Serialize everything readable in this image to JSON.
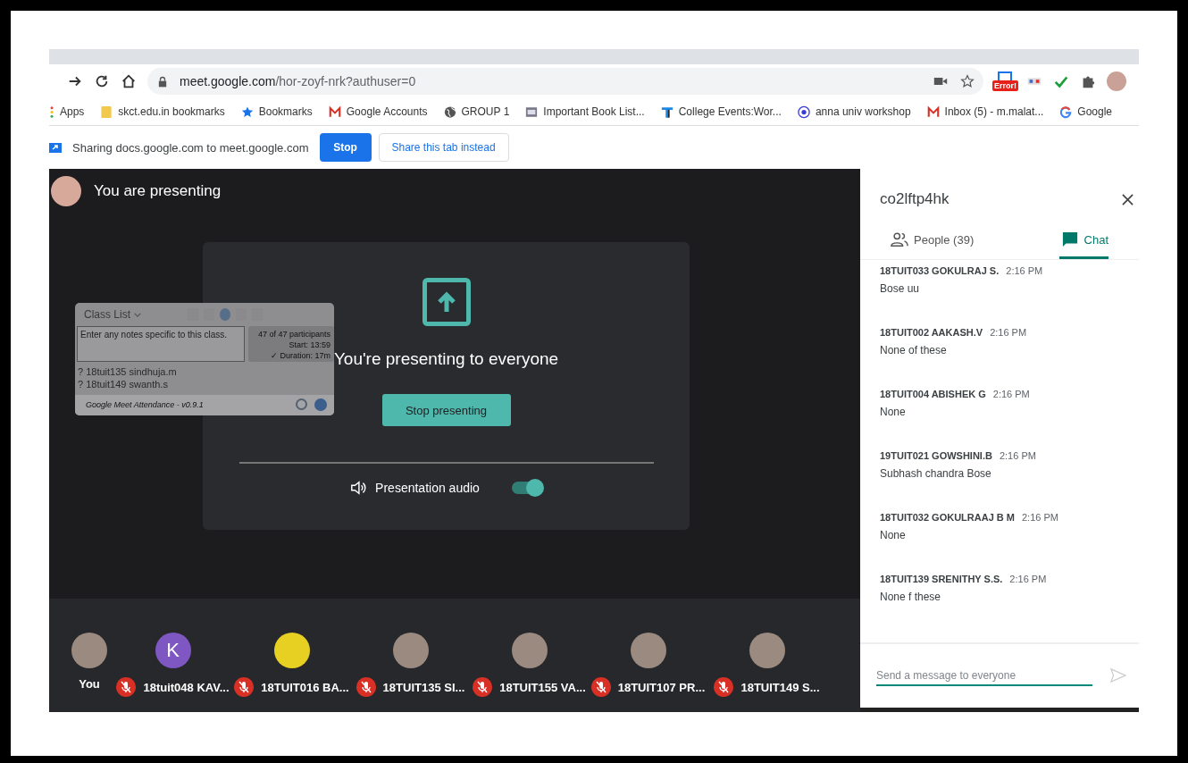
{
  "browser": {
    "address": {
      "host": "meet.google.com",
      "path": "/hor-zoyf-nrk?authuser=0"
    },
    "extension_badge": "Error!",
    "bookmarks": [
      {
        "label": "Apps",
        "kind": "apps"
      },
      {
        "label": "skct.edu.in bookmarks",
        "kind": "folder"
      },
      {
        "label": "Bookmarks",
        "kind": "star"
      },
      {
        "label": "Google Accounts",
        "kind": "mail"
      },
      {
        "label": "GROUP 1",
        "kind": "globe"
      },
      {
        "label": "Important Book List...",
        "kind": "book"
      },
      {
        "label": "College Events:Wor...",
        "kind": "t-logo"
      },
      {
        "label": "anna univ workshop",
        "kind": "emblem"
      },
      {
        "label": "Inbox (5) - m.malat...",
        "kind": "mail"
      },
      {
        "label": "Google",
        "kind": "google"
      }
    ]
  },
  "share_bar": {
    "message": "Sharing docs.google.com to meet.google.com",
    "stop": "Stop",
    "share_tab": "Share this tab instead"
  },
  "stage": {
    "title": "You are presenting",
    "class_list": {
      "title": "Class List",
      "notes_placeholder": "Enter any notes specific to this class.",
      "stats": [
        "47 of 47 participants",
        "Start: 13:59",
        "✓ Duration: 17m"
      ],
      "students": [
        "? 18tuit135 sindhuja.m",
        "? 18tuit149 swanth.s"
      ],
      "footer": "Google Meet Attendance - v0.9.1"
    },
    "card": {
      "message": "You're presenting to everyone",
      "button": "Stop presenting",
      "audio_label": "Presentation audio",
      "audio_on": true
    }
  },
  "participants": [
    {
      "name": "You",
      "muted": false,
      "kind": "photo"
    },
    {
      "name": "18tuit048 KAV...",
      "muted": true,
      "kind": "letter",
      "letter": "K"
    },
    {
      "name": "18TUIT016 BA...",
      "muted": true,
      "kind": "emoji"
    },
    {
      "name": "18TUIT135 SI...",
      "muted": true,
      "kind": "photo"
    },
    {
      "name": "18TUIT155 VA...",
      "muted": true,
      "kind": "photo"
    },
    {
      "name": "18TUIT107 PR...",
      "muted": true,
      "kind": "photo"
    },
    {
      "name": "18TUIT149 S...",
      "muted": true,
      "kind": "photo"
    }
  ],
  "panel": {
    "meeting_code": "co2lftp4hk",
    "tabs": [
      {
        "label": "People (39)",
        "kind": "people",
        "selected": false
      },
      {
        "label": "Chat",
        "kind": "chat",
        "selected": true
      }
    ],
    "messages": [
      {
        "sender": "18TUIT033 GOKULRAJ S.",
        "time": "2:16 PM",
        "text": "Bose uu"
      },
      {
        "sender": "18TUIT002 AAKASH.V",
        "time": "2:16 PM",
        "text": "None of these"
      },
      {
        "sender": "18TUIT004 ABISHEK G",
        "time": "2:16 PM",
        "text": "None"
      },
      {
        "sender": "19TUIT021 GOWSHINI.B",
        "time": "2:16 PM",
        "text": "Subhash chandra Bose"
      },
      {
        "sender": "18TUIT032 GOKULRAAJ B M",
        "time": "2:16 PM",
        "text": "None"
      },
      {
        "sender": "18TUIT139 SRENITHY S.S.",
        "time": "2:16 PM",
        "text": "None f these"
      }
    ],
    "input": {
      "placeholder": "Send a message to everyone"
    }
  }
}
